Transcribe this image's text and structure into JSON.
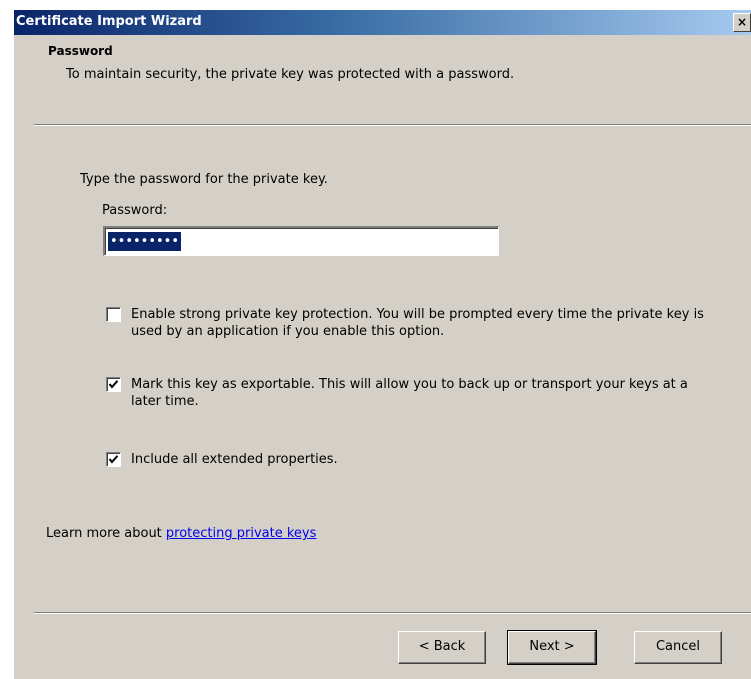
{
  "window": {
    "title": "Certificate Import Wizard",
    "close_glyph": "×"
  },
  "header": {
    "title": "Password",
    "subtitle": "To maintain security, the private key was protected with a password."
  },
  "form": {
    "prompt": "Type the password for the private key.",
    "password_label": "Password:",
    "password_value": "•••••••••"
  },
  "options": [
    {
      "label": "Enable strong private key protection. You will be prompted every time the private key is used by an application if you enable this option.",
      "checked": false
    },
    {
      "label": "Mark this key as exportable. This will allow you to back up or transport your keys at a later time.",
      "checked": true
    },
    {
      "label": "Include all extended properties.",
      "checked": true
    }
  ],
  "learn_more": {
    "prefix": "Learn more about ",
    "link": "protecting private keys"
  },
  "buttons": {
    "back": "< Back",
    "next": "Next >",
    "cancel": "Cancel"
  },
  "colors": {
    "dialog_bg": "#d4d0c8",
    "titlebar_start": "#0a246a",
    "titlebar_end": "#a6caf0",
    "link": "#0000ee",
    "selection": "#0a246a"
  },
  "icons": [
    "close-icon",
    "checkmark-icon"
  ]
}
